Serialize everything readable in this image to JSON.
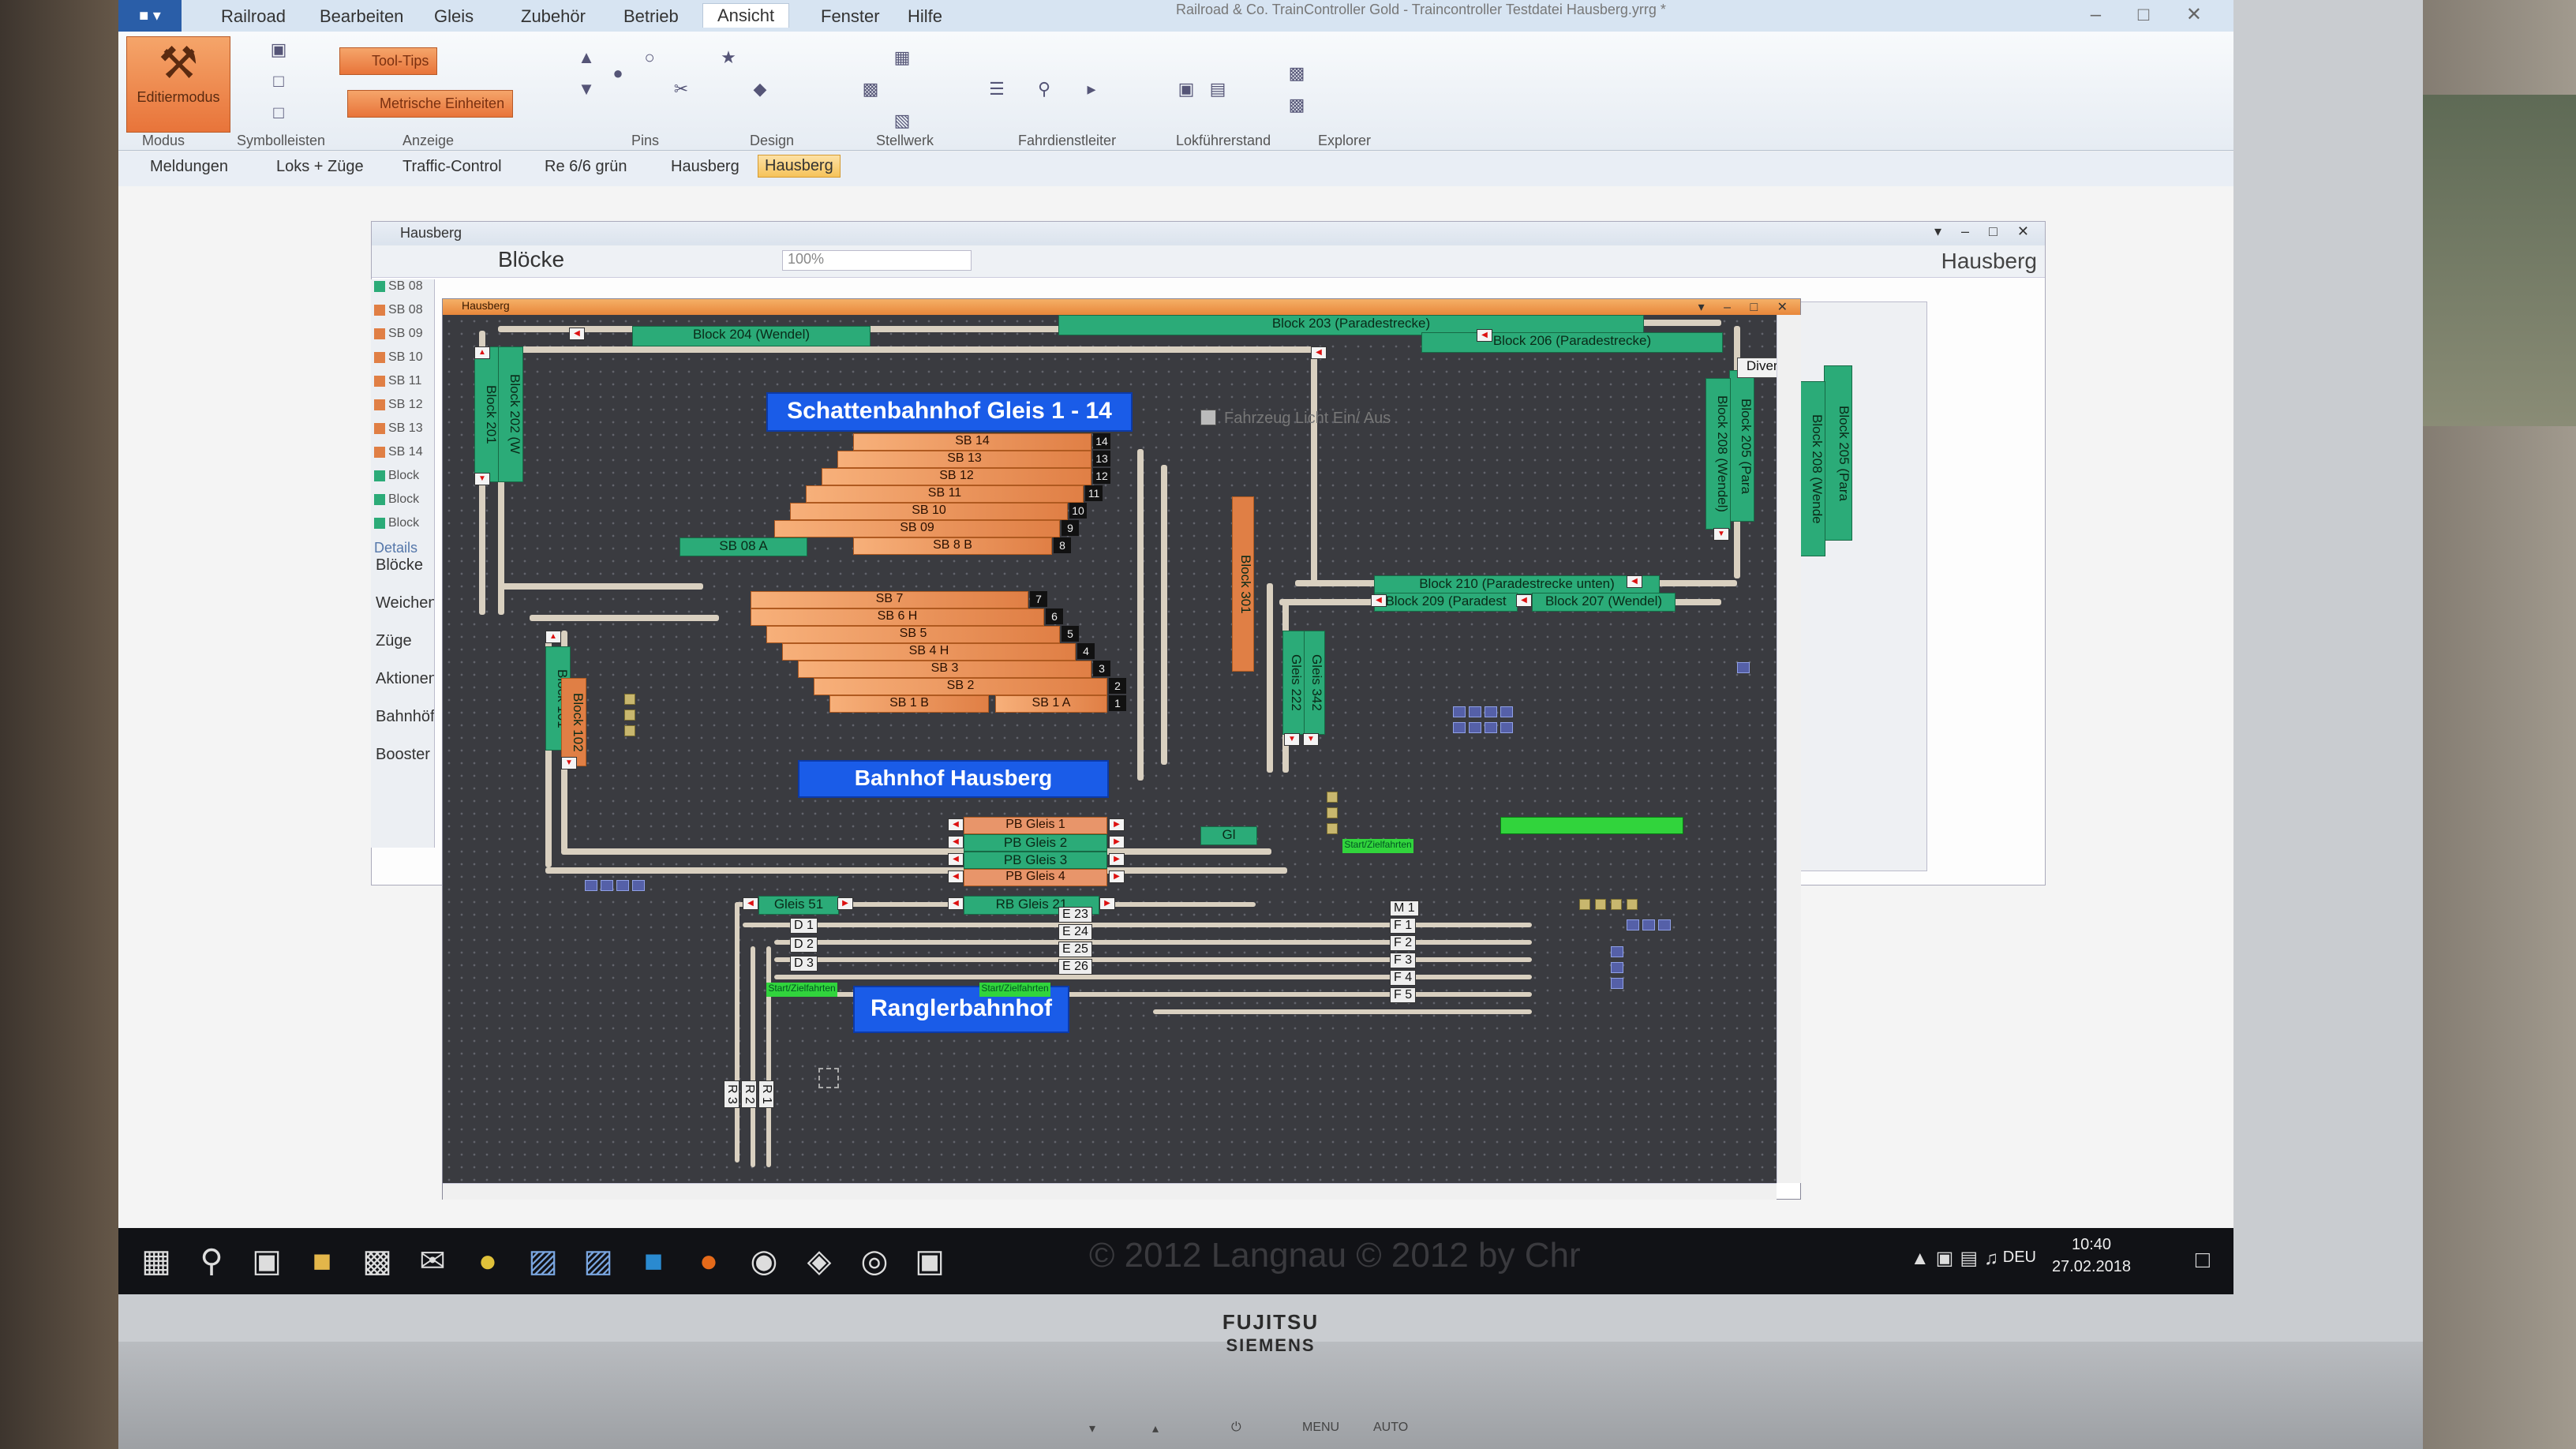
{
  "app": {
    "title": "Railroad & Co. TrainController Gold - Traincontroller Testdatei Hausberg.yrrg *",
    "file_menu": "■ ▾",
    "window_controls": "– □ ✕"
  },
  "ribbon": {
    "tabs": [
      "Railroad",
      "Bearbeiten",
      "Gleis",
      "Zubehör",
      "Betrieb",
      "Ansicht",
      "Fenster",
      "Hilfe"
    ],
    "active_tab": "Ansicht",
    "edit_mode_label": "Editiermodus",
    "tooltips_label": "Tool-Tips",
    "metric_label": "Metrische Einheiten",
    "groups": [
      "Modus",
      "Symbolleisten",
      "Anzeige",
      "Pins",
      "Design",
      "Stellwerk",
      "Fahrdienstleiter",
      "Lokführerstand",
      "Explorer"
    ]
  },
  "quickbar": {
    "tabs": [
      "Meldungen",
      "Loks + Züge",
      "Traffic-Control",
      "Re 6/6 grün",
      "Hausberg",
      "Hausberg"
    ],
    "active_index": 5
  },
  "outer_window": {
    "title": "Hausberg",
    "toolbar_label": "Blöcke",
    "zoom": "100%",
    "right_title": "Hausberg",
    "controls": "▾ – □ ✕"
  },
  "left_panel": {
    "rows": [
      "SB 08",
      "SB 08",
      "SB 09",
      "SB 10",
      "SB 11",
      "SB 12",
      "SB 13",
      "SB 14",
      "Block",
      "Block",
      "Block"
    ],
    "details": "Details",
    "nav": [
      "Blöcke",
      "Weichen",
      "Züge",
      "Aktionen",
      "Bahnhöfe",
      "Booster"
    ]
  },
  "inner_window": {
    "title": "Hausberg",
    "controls": "▾ – □ ✕"
  },
  "plan": {
    "stations": {
      "schatten": "Schattenbahnhof Gleis 1 - 14",
      "hausberg": "Bahnhof Hausberg",
      "rangier": "Ranglerbahnhof"
    },
    "divers": "Divers",
    "checkbox_label": "Fahrzeug Licht Ein/ Aus",
    "blocks": {
      "b204": "Block 204 (Wendel)",
      "b203": "Block 203 (Paradestrecke)",
      "b206": "Block 206 (Paradestrecke)",
      "b201": "Block 201",
      "b202": "Block 202 (W",
      "b205": "Block 205 (Para",
      "b208": "Block 208 (Wendel)",
      "b210": "Block 210 (Paradestrecke unten)",
      "b209": "Block 209 (Paradest",
      "b207": "Block 207 (Wendel)",
      "b101": "Block 101",
      "b102": "Block 102",
      "gleis342": "Gleis 342",
      "gleis222": "Gleis 222",
      "gl": "Gl",
      "gleis51": "Gleis 51",
      "rb21": "RB Gleis 21",
      "right205": "Block 205 (Para",
      "right208": "Block 208 (Wende",
      "sb_vert": "Block 301"
    },
    "sb_upper": [
      "SB 14",
      "SB 13",
      "SB 12",
      "SB 11",
      "SB 10",
      "SB 09",
      "SB 8 B"
    ],
    "sb08a": "SB 08 A",
    "sb_lower": [
      "SB 7",
      "SB 6 H",
      "SB 5",
      "SB 4 H",
      "SB 3",
      "SB 2",
      "SB 1 B"
    ],
    "sb1a": "SB 1 A",
    "sb_nums_upper": [
      "14",
      "13",
      "12",
      "11",
      "10",
      "9",
      "8"
    ],
    "sb_nums_lower": [
      "7",
      "6",
      "5",
      "4",
      "3",
      "2",
      "1"
    ],
    "pb": [
      "PB Gleis 1",
      "PB Gleis 2",
      "PB Gleis 3",
      "PB Gleis 4"
    ],
    "depot_d": [
      "D 1",
      "D 2",
      "D 3"
    ],
    "depot_e": [
      "E 23",
      "E 24",
      "E 25",
      "E 26"
    ],
    "depot_f": [
      "M 1",
      "F 1",
      "F 2",
      "F 3",
      "F 4",
      "F 5"
    ],
    "depot_r": [
      "R 3",
      "R 2",
      "R 1"
    ],
    "startziel": "Start/Zielfahrten"
  },
  "taskbar": {
    "icons": [
      "windows-icon",
      "search-icon",
      "task-view-icon",
      "explorer-icon",
      "store-icon",
      "mail-icon",
      "chrome-icon",
      "traincontroller-icon",
      "traincontroller2-icon",
      "esu-icon",
      "firefox-icon",
      "app1-icon",
      "app2-icon",
      "app3-icon",
      "camera-icon"
    ],
    "watermark": "© 2012 Langnau          © 2012 by Chr",
    "lang": "DEU",
    "time": "10:40",
    "date": "27.02.2018"
  },
  "monitor": {
    "brand": "FUJITSU",
    "brand_sub": "SIEMENS",
    "buttons": [
      "▾",
      "▴",
      "⏻",
      "MENU",
      "AUTO"
    ]
  }
}
